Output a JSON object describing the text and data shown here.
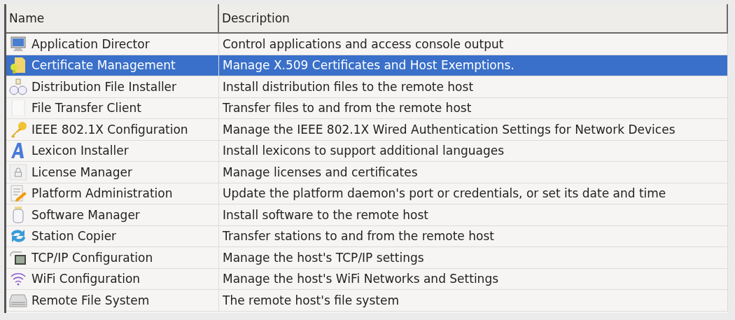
{
  "table": {
    "columns": [
      "Name",
      "Description"
    ],
    "rows": [
      {
        "kind": "monitor",
        "name": "Application Director",
        "description": "Control applications and access console output",
        "selected": false
      },
      {
        "kind": "certificate",
        "name": "Certificate Management",
        "description": "Manage X.509 Certificates and Host Exemptions.",
        "selected": true
      },
      {
        "kind": "jars",
        "name": "Distribution File Installer",
        "description": "Install distribution files to the remote host",
        "selected": false
      },
      {
        "kind": "blank",
        "name": "File Transfer Client",
        "description": "Transfer files to and from the remote host",
        "selected": false
      },
      {
        "kind": "key",
        "name": "IEEE 802.1X Configuration",
        "description": "Manage the IEEE 802.1X Wired Authentication Settings for Network Devices",
        "selected": false
      },
      {
        "kind": "letter",
        "name": "Lexicon Installer",
        "description": "Install lexicons to support additional languages",
        "selected": false
      },
      {
        "kind": "lock",
        "name": "License Manager",
        "description": "Manage licenses and certificates",
        "selected": false
      },
      {
        "kind": "edit",
        "name": "Platform Administration",
        "description": "Update the platform daemon's port or credentials, or set its date and time",
        "selected": false
      },
      {
        "kind": "jar",
        "name": "Software Manager",
        "description": "Install software to the remote host",
        "selected": false
      },
      {
        "kind": "sync",
        "name": "Station Copier",
        "description": "Transfer stations to and from the remote host",
        "selected": false
      },
      {
        "kind": "network",
        "name": "TCP/IP Configuration",
        "description": "Manage the host's TCP/IP settings",
        "selected": false
      },
      {
        "kind": "wifi",
        "name": "WiFi Configuration",
        "description": "Manage the host's WiFi Networks and Settings",
        "selected": false
      },
      {
        "kind": "drive",
        "name": "Remote File System",
        "description": "The remote host's file system",
        "selected": false
      }
    ]
  }
}
